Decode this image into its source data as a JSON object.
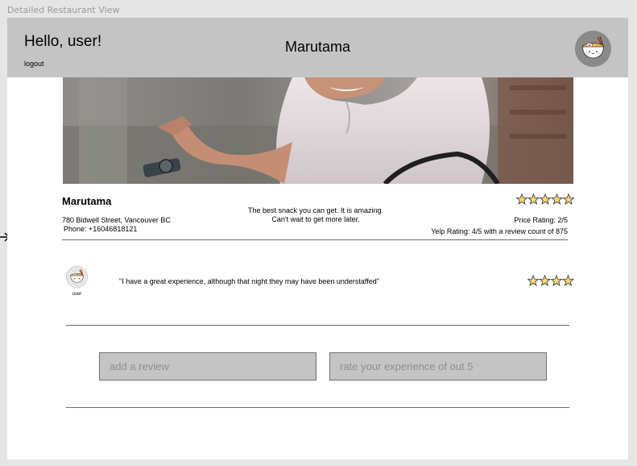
{
  "frame_label": "Detailed Restaurant View",
  "header": {
    "greeting": "Hello, user!",
    "logout_label": "logout",
    "title": "Marutama"
  },
  "restaurant": {
    "name": "Marutama",
    "address": "780 Bidwell Street, Vancouver BC",
    "phone": "Phone: +16046818121",
    "description_line1": "The best snack you can get. It is amazing.",
    "description_line2": "Can't wait to get more later.",
    "star_count": 5,
    "price_rating": "Price Rating: 2/5",
    "yelp_rating": "Yelp Rating: 4/5 with a review count of 875"
  },
  "review": {
    "username": "user",
    "text": "\"I have a great experience, although that night they may have been understaffed\"",
    "star_count": 4
  },
  "form": {
    "review_placeholder": "add a review",
    "rating_placeholder": "rate your experience of out 5"
  },
  "colors": {
    "header_bg": "#c4c4c4",
    "star_fill": "#f6d77e",
    "avatar_bg": "#8a8a8a"
  },
  "icons": {
    "top_avatar": "ramen-bowl-icon",
    "review_avatar": "ramen-bowl-icon",
    "star": "star-icon",
    "arrow": "arrow-right-icon"
  }
}
